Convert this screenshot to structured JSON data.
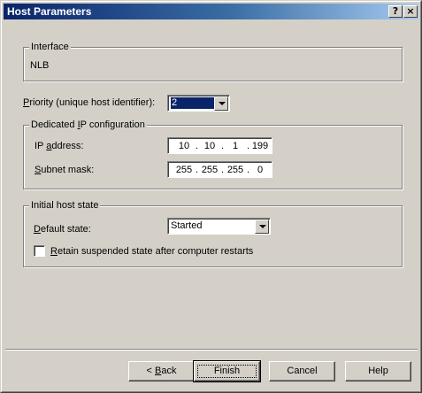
{
  "window": {
    "title": "Host Parameters",
    "help_button": "?",
    "close_button": "×"
  },
  "interface": {
    "group_label": "Interface",
    "value": "NLB"
  },
  "priority": {
    "label_pre": "P",
    "label_rest": "riority (unique host identifier):",
    "selected": "2"
  },
  "dedicated_ip": {
    "group_label_pre": "Dedicated ",
    "group_label_accel": "I",
    "group_label_post": "P configuration",
    "ip_label_pre": "IP ",
    "ip_label_accel": "a",
    "ip_label_post": "ddress:",
    "ip_octets": [
      "10",
      "10",
      "1",
      "199"
    ],
    "subnet_label_accel": "S",
    "subnet_label_post": "ubnet mask:",
    "subnet_octets": [
      "255",
      "255",
      "255",
      "0"
    ]
  },
  "initial_state": {
    "group_label": "Initial host state",
    "default_label_pre": "D",
    "default_label_post": "efault state:",
    "default_value": "Started",
    "retain_label_accel": "R",
    "retain_label_post": "etain suspended state after computer restarts",
    "retain_checked": false
  },
  "buttons": {
    "back_pre": "< ",
    "back_accel": "B",
    "back_post": "ack",
    "finish": "Finish",
    "cancel": "Cancel",
    "help": "Help"
  },
  "colors": {
    "title_gradient_start": "#0a246a",
    "title_gradient_end": "#a6caf0",
    "selection_highlight": "#0a246a",
    "face": "#d4d0c8"
  }
}
